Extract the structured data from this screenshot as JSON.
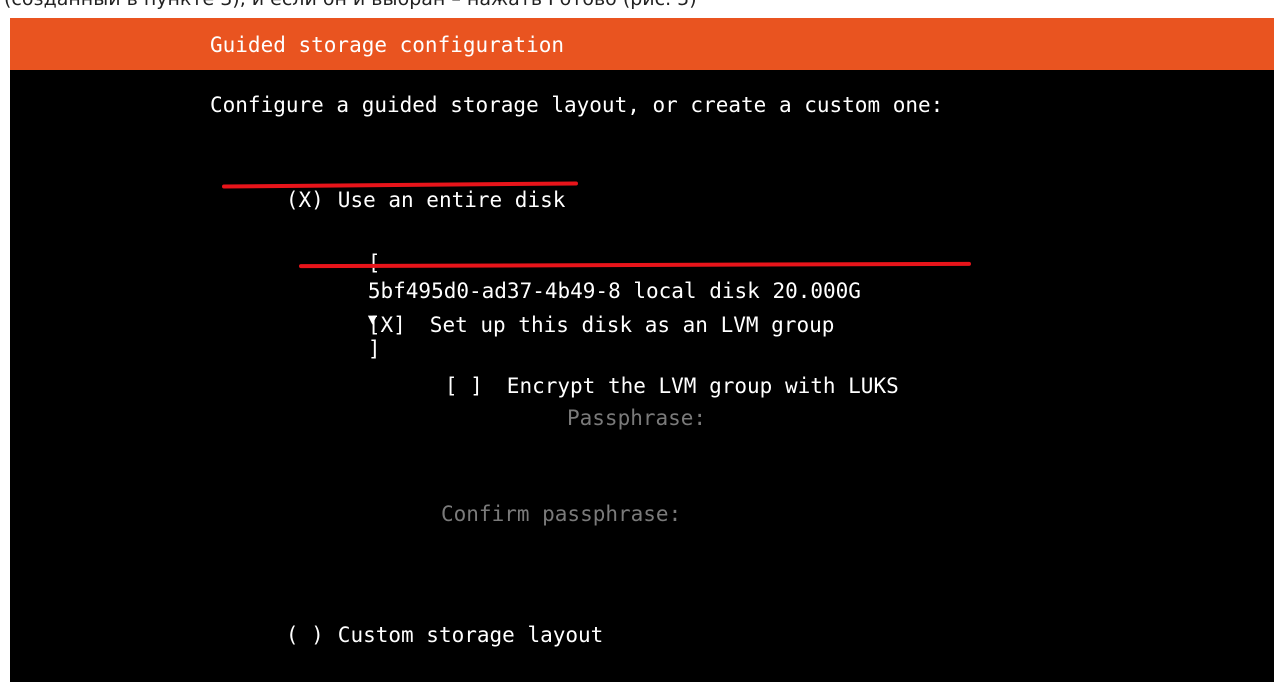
{
  "caption": {
    "text": "(созданный в пункте 3), и если он и выбран – нажать Готово (рис. 5)"
  },
  "header": {
    "title": "Guided storage configuration"
  },
  "main": {
    "description": "Configure a guided storage layout, or create a custom one:",
    "entire_disk": {
      "marker": "(X)",
      "label": "Use an entire disk"
    },
    "disk_select": {
      "open_bracket": "[",
      "value": "5bf495d0-ad37-4b49-8 local disk 20.000G",
      "close_bracket": "]"
    },
    "lvm": {
      "marker": "[X]",
      "label": "Set up this disk as an LVM group"
    },
    "luks": {
      "marker": "[ ]",
      "label": "Encrypt the LVM group with LUKS"
    },
    "passphrase_label": "Passphrase:",
    "confirm_passphrase_label": "Confirm passphrase:",
    "custom_layout": {
      "marker": "( )",
      "label": "Custom storage layout"
    }
  },
  "colors": {
    "header_bg": "#e95420",
    "terminal_bg": "#000000",
    "annotation": "#e8141a",
    "disabled_text": "#7a7a7a"
  }
}
